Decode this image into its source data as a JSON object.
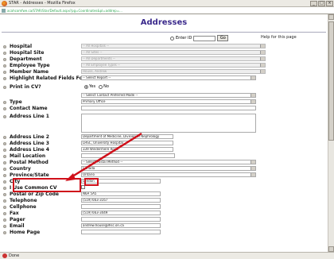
{
  "window": {
    "title": "STAR - Addresses - Mozilla Firefox",
    "minimize": "_",
    "maximize": "□",
    "close": "×"
  },
  "url": "acahcomfwe.ca/STAR/Star/Default.aspx?pg=Coordinates&pl=addrep=...",
  "status": "Done",
  "page": {
    "title": "Addresses",
    "enter_id_label": "Enter ID",
    "go_label": "Go",
    "help_link": "Help for this page"
  },
  "fields": [
    {
      "label": "Hospital",
      "value": "-- All Hospitals --",
      "kind": "select",
      "disabled": true
    },
    {
      "label": "Hospital Site",
      "value": "-- All Sites --",
      "kind": "select",
      "disabled": true
    },
    {
      "label": "Department",
      "value": "-- All Departments --",
      "kind": "select",
      "disabled": true
    },
    {
      "label": "Employee Type",
      "value": "-- All Employee Types --",
      "kind": "select",
      "disabled": true
    },
    {
      "label": "Member Name",
      "value": "House, Andrew",
      "kind": "select",
      "disabled": true
    },
    {
      "label": "Highlight Related Fields For",
      "value": "-- Select Report --",
      "kind": "select",
      "disabled": false
    },
    {
      "label": "Print in CV?",
      "kind": "radio",
      "options": [
        "Yes",
        "No"
      ],
      "selected": "Yes"
    },
    {
      "label": "",
      "value": "-- Select Contact Preferred Mode --",
      "kind": "select",
      "disabled": false
    },
    {
      "label": "Type",
      "value": "Primary Office",
      "kind": "select",
      "disabled": false
    },
    {
      "label": "Contact Name",
      "value": "",
      "kind": "text"
    },
    {
      "label": "Address Line 1",
      "value": "",
      "kind": "textarea"
    },
    {
      "label": "Address Line 2",
      "value": "Department of Medicine, Division of Nephrology",
      "kind": "text"
    },
    {
      "label": "Address Line 3",
      "value": "LHSC, University Hospital",
      "kind": "text"
    },
    {
      "label": "Address Line 4",
      "value": "339 Windermere Road",
      "kind": "text"
    },
    {
      "label": "Mail Location",
      "value": "",
      "kind": "text"
    },
    {
      "label": "Postal Method",
      "value": "-- Select Postal Method --",
      "kind": "select",
      "disabled": false
    },
    {
      "label": "Country",
      "value": "Canada",
      "kind": "select",
      "disabled": false
    },
    {
      "label": "Province/State",
      "value": "Ontario",
      "kind": "select",
      "disabled": false
    },
    {
      "label": "City",
      "value": "London",
      "kind": "text"
    },
    {
      "label": "I Use Common CV",
      "kind": "checkbox"
    },
    {
      "label": "Postal or Zip Code",
      "value": "N6A 5A5",
      "kind": "text"
    },
    {
      "label": "Telephone",
      "value": "(519) 663-3167",
      "kind": "text"
    },
    {
      "label": "Cellphone",
      "value": "",
      "kind": "text"
    },
    {
      "label": "Fax",
      "value": "(519) 663-3449",
      "kind": "text"
    },
    {
      "label": "Pager",
      "value": "",
      "kind": "text"
    },
    {
      "label": "Email",
      "value": "andrew.house@lhsc.on.ca",
      "kind": "text"
    },
    {
      "label": "Home Page",
      "value": "",
      "kind": "text"
    }
  ],
  "annotation_color": "#d0101a"
}
